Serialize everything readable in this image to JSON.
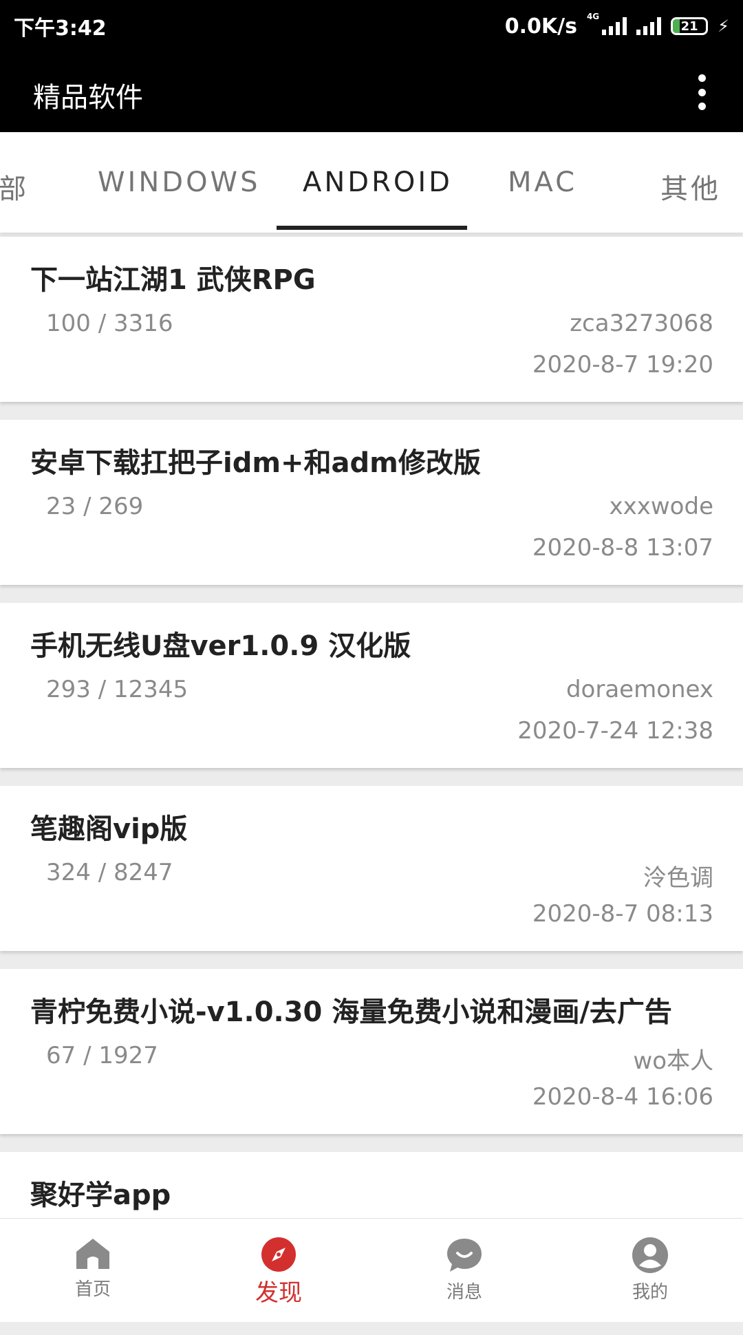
{
  "status_bar": {
    "time": "下午3:42",
    "net_speed": "0.0K/s",
    "net_type": "4G",
    "battery": "21",
    "battery_level_pct": 21
  },
  "app_bar": {
    "title": "精品软件",
    "menu_icon": "more-vert-icon"
  },
  "tabs": [
    {
      "label": "部"
    },
    {
      "label": "WINDOWS"
    },
    {
      "label": "ANDROID",
      "active": true
    },
    {
      "label": "MAC"
    },
    {
      "label": "其他"
    }
  ],
  "posts": [
    {
      "title": "下一站江湖1 武侠RPG",
      "stats": "100 / 3316",
      "author": "zca3273068",
      "date": "2020-8-7 19:20"
    },
    {
      "title": "安卓下载扛把子idm+和adm修改版",
      "stats": "23 / 269",
      "author": "xxxwode",
      "date": "2020-8-8 13:07"
    },
    {
      "title": "手机无线U盘ver1.0.9 汉化版",
      "stats": "293 / 12345",
      "author": "doraemonex",
      "date": "2020-7-24 12:38"
    },
    {
      "title": "笔趣阁vip版",
      "stats": "324 / 8247",
      "author": "泠色调",
      "date": "2020-8-7 08:13"
    },
    {
      "title": "青柠免费小说-v1.0.30 海量免费小说和漫画/去广告",
      "stats": "67 / 1927",
      "author": "wo本人",
      "date": "2020-8-4 16:06"
    },
    {
      "title": "聚好学app",
      "stats": "",
      "author": "",
      "date": ""
    }
  ],
  "bottom_nav": [
    {
      "label": "首页",
      "icon": "home-icon"
    },
    {
      "label": "发现",
      "icon": "compass-icon",
      "active": true
    },
    {
      "label": "消息",
      "icon": "chat-bubble-icon"
    },
    {
      "label": "我的",
      "icon": "person-icon"
    }
  ],
  "colors": {
    "accent": "#d32f2f",
    "app_bar": "#000000",
    "inactive_icon": "#8a8a8a"
  }
}
